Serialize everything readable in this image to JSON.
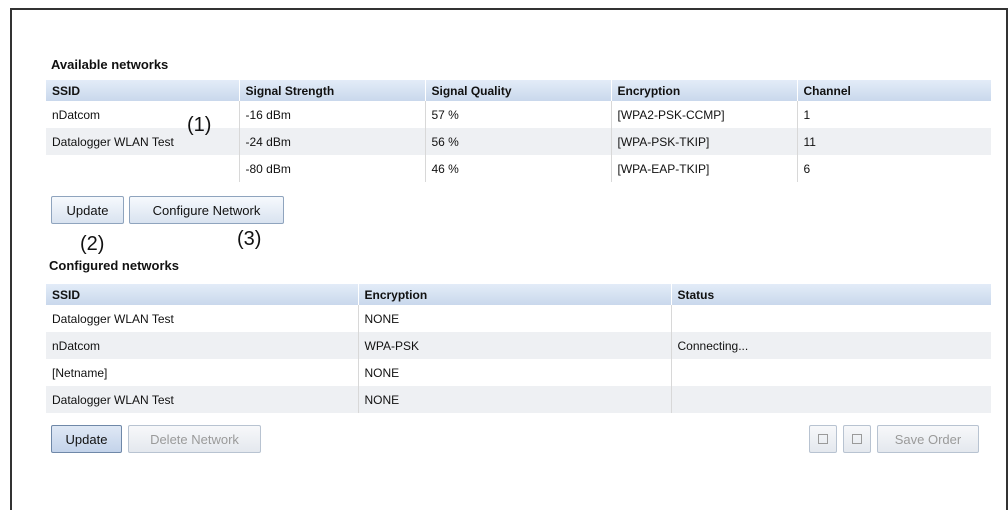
{
  "available": {
    "title": "Available networks",
    "headers": [
      "SSID",
      "Signal Strength",
      "Signal Quality",
      "Encryption",
      "Channel"
    ],
    "rows": [
      [
        "nDatcom",
        "-16 dBm",
        "57 %",
        "[WPA2-PSK-CCMP]",
        "1"
      ],
      [
        "Datalogger WLAN Test",
        "-24 dBm",
        "56 %",
        "[WPA-PSK-TKIP]",
        "11"
      ],
      [
        "",
        "-80 dBm",
        "46 %",
        "[WPA-EAP-TKIP]",
        "6"
      ]
    ],
    "update_label": "Update",
    "configure_label": "Configure Network"
  },
  "configured": {
    "title": "Configured networks",
    "headers": [
      "SSID",
      "Encryption",
      "Status"
    ],
    "rows": [
      [
        "Datalogger WLAN Test",
        "NONE",
        ""
      ],
      [
        "nDatcom",
        "WPA-PSK",
        "Connecting..."
      ],
      [
        "[Netname]",
        "NONE",
        ""
      ],
      [
        "Datalogger WLAN Test",
        "NONE",
        ""
      ]
    ],
    "update_label": "Update",
    "delete_label": "Delete Network",
    "save_order_label": "Save Order",
    "move_up_icon": "square-icon",
    "move_down_icon": "square-icon"
  },
  "callouts": {
    "c1": "(1)",
    "c2": "(2)",
    "c3": "(3)"
  }
}
